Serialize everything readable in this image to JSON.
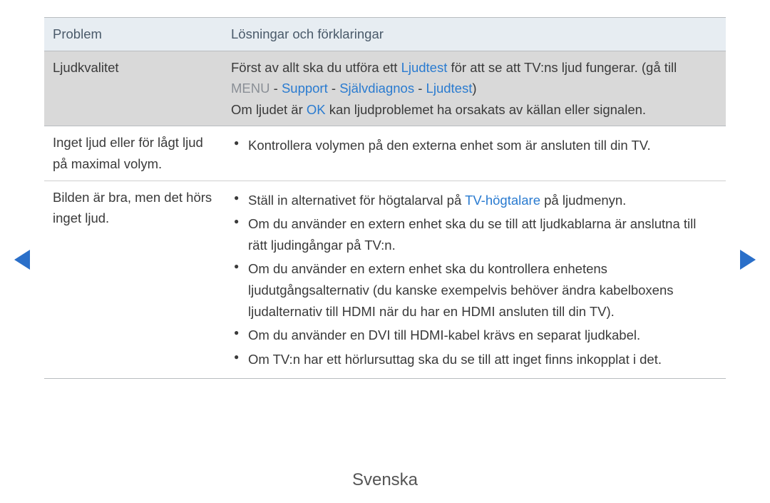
{
  "nav": {
    "prev": "previous page",
    "next": "next page"
  },
  "table": {
    "header": {
      "problem": "Problem",
      "solution": "Lösningar och förklaringar"
    },
    "rows": {
      "sound_quality": {
        "problem": "Ljudkvalitet",
        "line1_pre": "Först av allt ska du utföra ett ",
        "line1_hl": "Ljudtest",
        "line1_post": " för att se att TV:ns ljud fungerar. (gå till ",
        "path_menu": "MENU",
        "path_sep1": " - ",
        "path_support": "Support",
        "path_sep2": " - ",
        "path_diag": "Självdiagnos",
        "path_sep3": " - ",
        "path_test": "Ljudtest",
        "path_close": ")",
        "line3_pre": "Om ljudet är ",
        "line3_hl": "OK",
        "line3_post": " kan ljudproblemet ha orsakats av källan eller signalen."
      },
      "no_sound": {
        "problem": "Inget ljud eller för lågt ljud på maximal volym.",
        "bullet1": "Kontrollera volymen på den externa enhet som är ansluten till din TV."
      },
      "pic_ok": {
        "problem": "Bilden är bra, men det hörs inget ljud.",
        "b1_pre": "Ställ in alternativet för högtalarval på ",
        "b1_hl": "TV-högtalare",
        "b1_post": " på ljudmenyn.",
        "b2": "Om du använder en extern enhet ska du se till att ljudkablarna är anslutna till rätt ljudingångar på TV:n.",
        "b3": "Om du använder en extern enhet ska du kontrollera enhetens ljudutgångsalternativ (du kanske exempelvis behöver ändra kabelboxens ljudalternativ till HDMI när du har en HDMI ansluten till din TV).",
        "b4": "Om du använder en DVI till HDMI-kabel krävs en separat ljudkabel.",
        "b5": "Om TV:n har ett hörlursuttag ska du se till att inget finns inkopplat i det."
      }
    }
  },
  "footer": {
    "language": "Svenska"
  }
}
